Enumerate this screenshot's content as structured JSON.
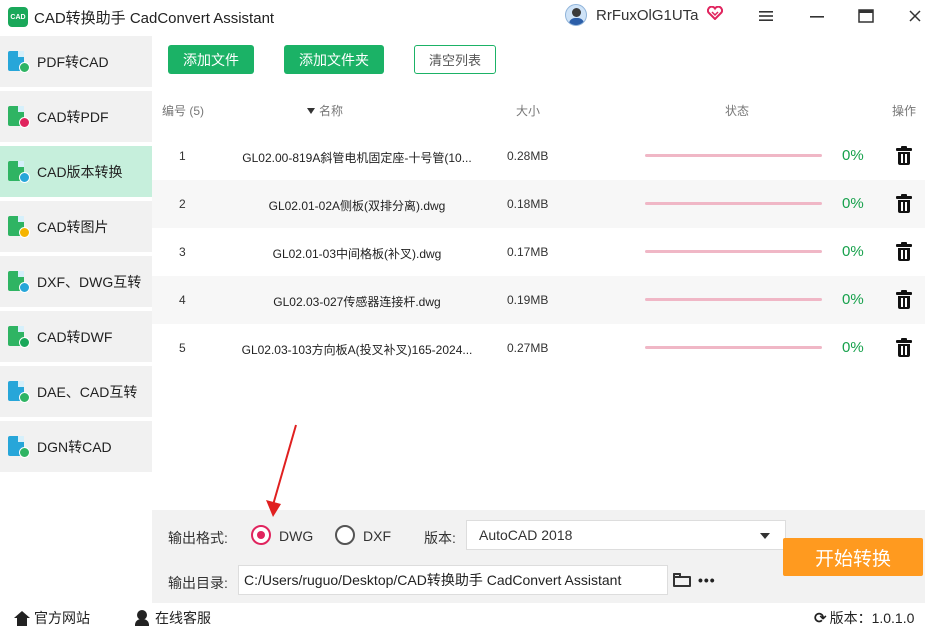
{
  "titlebar": {
    "logo_text": "CAD",
    "title": "CAD转换助手 CadConvert Assistant",
    "username": "RrFuxOlG1UTa",
    "vip_icon": "heart-diamond-icon",
    "minimize_icon": "minimize-icon",
    "menu_icon": "hamburger-icon",
    "maximize_icon": "maximize-icon",
    "close_icon": "close-icon"
  },
  "sidebar": {
    "items": [
      {
        "label": "PDF转CAD",
        "active": false
      },
      {
        "label": "CAD转PDF",
        "active": false
      },
      {
        "label": "CAD版本转换",
        "active": true
      },
      {
        "label": "CAD转图片",
        "active": false
      },
      {
        "label": "DXF、DWG互转",
        "active": false
      },
      {
        "label": "CAD转DWF",
        "active": false
      },
      {
        "label": "DAE、CAD互转",
        "active": false
      },
      {
        "label": "DGN转CAD",
        "active": false
      }
    ]
  },
  "toolbar": {
    "add_file": "添加文件",
    "add_folder": "添加文件夹",
    "clear_list": "清空列表"
  },
  "table": {
    "headers": {
      "index": "编号 (5)",
      "name": "名称",
      "size": "大小",
      "status": "状态",
      "action": "操作"
    },
    "rows": [
      {
        "index": "1",
        "name": "GL02.00-819A斜管电机固定座-十号管(10...",
        "size": "0.28MB",
        "progress": 0,
        "percent": "0%"
      },
      {
        "index": "2",
        "name": "GL02.01-02A侧板(双排分离).dwg",
        "size": "0.18MB",
        "progress": 0,
        "percent": "0%"
      },
      {
        "index": "3",
        "name": "GL02.01-03中间格板(补叉).dwg",
        "size": "0.17MB",
        "progress": 0,
        "percent": "0%"
      },
      {
        "index": "4",
        "name": "GL02.03-027传感器连接杆.dwg",
        "size": "0.19MB",
        "progress": 0,
        "percent": "0%"
      },
      {
        "index": "5",
        "name": "GL02.03-103方向板A(投叉补叉)165-2024...",
        "size": "0.27MB",
        "progress": 0,
        "percent": "0%"
      }
    ]
  },
  "settings": {
    "format_label": "输出格式:",
    "format_options": [
      "DWG",
      "DXF"
    ],
    "format_selected": "DWG",
    "version_label": "版本:",
    "version_value": "AutoCAD 2018",
    "output_label": "输出目录:",
    "output_path": "C:/Users/ruguo/Desktop/CAD转换助手 CadConvert Assistant",
    "start_button": "开始转换"
  },
  "statusbar": {
    "website": "官方网站",
    "service": "在线客服",
    "version": "版本：1.0.1.0"
  },
  "colors": {
    "green": "#1bb266",
    "active_side": "#c6efdc",
    "orange": "#ff9a1f",
    "pink": "#e0245e",
    "percent_green": "#17a14c"
  }
}
